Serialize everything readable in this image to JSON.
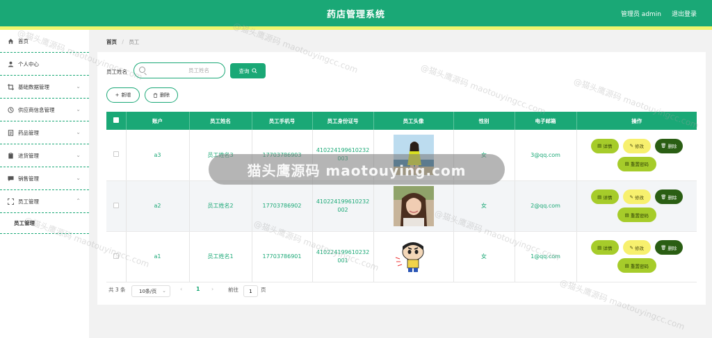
{
  "header": {
    "title": "药店管理系统",
    "admin": "管理员 admin",
    "logout": "退出登录"
  },
  "sidebar": {
    "items": [
      {
        "label": "首页",
        "icon": "home-icon"
      },
      {
        "label": "个人中心",
        "icon": "user-icon"
      },
      {
        "label": "基础数据管理",
        "icon": "crop-icon"
      },
      {
        "label": "供应商信息管理",
        "icon": "clock-icon"
      },
      {
        "label": "药品管理",
        "icon": "document-icon"
      },
      {
        "label": "进货管理",
        "icon": "clipboard-icon"
      },
      {
        "label": "销售管理",
        "icon": "chat-icon"
      },
      {
        "label": "员工管理",
        "icon": "fullscreen-icon"
      }
    ],
    "sub_item": "员工管理"
  },
  "breadcrumb": {
    "home": "首页",
    "current": "员工"
  },
  "search": {
    "label": "员工姓名",
    "placeholder": "员工姓名",
    "button": "查询"
  },
  "actions": {
    "add": "新增",
    "delete": "删除"
  },
  "table": {
    "headers": [
      "账户",
      "员工姓名",
      "员工手机号",
      "员工身份证号",
      "员工头像",
      "性别",
      "电子邮箱",
      "操作"
    ],
    "rows": [
      {
        "account": "a3",
        "name": "员工姓名3",
        "phone": "17703786903",
        "id_card": "410224199610232003",
        "gender": "女",
        "email": "3@qq.com"
      },
      {
        "account": "a2",
        "name": "员工姓名2",
        "phone": "17703786902",
        "id_card": "410224199610232002",
        "gender": "女",
        "email": "2@qq.com"
      },
      {
        "account": "a1",
        "name": "员工姓名1",
        "phone": "17703786901",
        "id_card": "410224199610232001",
        "gender": "女",
        "email": "1@qq.com"
      }
    ],
    "ops": {
      "detail": "详情",
      "edit": "修改",
      "delete": "删除",
      "reset": "重置密码"
    }
  },
  "pagination": {
    "total": "共 3 条",
    "page_size": "10条/页",
    "current": "1",
    "goto_label": "前往",
    "goto_value": "1",
    "page_unit": "页"
  },
  "watermark": {
    "band_text": "猫头鹰源码 maotouying.com",
    "text": "@猫头鹰源码 maotouyingcc.com"
  },
  "colors": {
    "primary": "#1aa876",
    "strip": "#f0f56e",
    "detail": "#a6cc2a",
    "edit": "#f7f06e",
    "delete": "#2a5e13"
  }
}
